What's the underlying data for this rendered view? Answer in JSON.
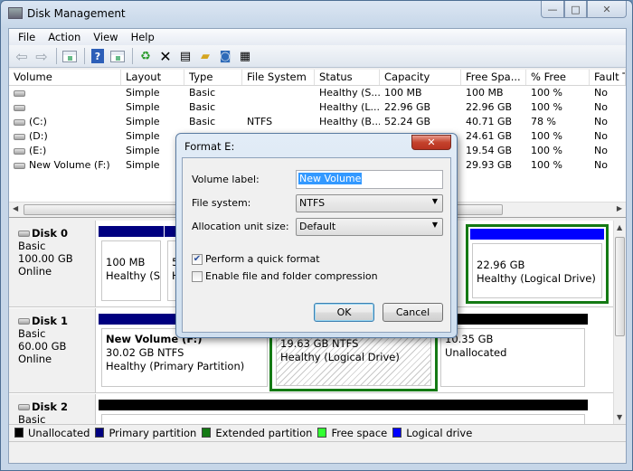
{
  "window": {
    "title": "Disk Management",
    "controls": {
      "minimize": "—",
      "maximize": "□",
      "close": "✕"
    }
  },
  "menu": [
    "File",
    "Action",
    "View",
    "Help"
  ],
  "toolbar": {
    "icons": [
      "back-icon",
      "forward-icon",
      "show-hide-console-tree-icon",
      "help-icon",
      "show-action-pane-icon",
      "refresh-icon",
      "delete-icon",
      "properties-icon",
      "open-icon",
      "explore-icon",
      "settings-icon"
    ]
  },
  "volume_list": {
    "columns": [
      "Volume",
      "Layout",
      "Type",
      "File System",
      "Status",
      "Capacity",
      "Free Spa...",
      "% Free",
      "Fault T"
    ],
    "rows": [
      {
        "volume": "",
        "layout": "Simple",
        "type": "Basic",
        "fs": "",
        "status": "Healthy (S...",
        "capacity": "100 MB",
        "free": "100 MB",
        "pct": "100 %",
        "fault": "No"
      },
      {
        "volume": "",
        "layout": "Simple",
        "type": "Basic",
        "fs": "",
        "status": "Healthy (L...",
        "capacity": "22.96 GB",
        "free": "22.96 GB",
        "pct": "100 %",
        "fault": "No"
      },
      {
        "volume": "(C:)",
        "layout": "Simple",
        "type": "Basic",
        "fs": "NTFS",
        "status": "Healthy (B...",
        "capacity": "52.24 GB",
        "free": "40.71 GB",
        "pct": "78 %",
        "fault": "No"
      },
      {
        "volume": "(D:)",
        "layout": "Simple",
        "type": "",
        "fs": "",
        "status": "",
        "capacity": "",
        "free": "24.61 GB",
        "pct": "100 %",
        "fault": "No"
      },
      {
        "volume": "(E:)",
        "layout": "Simple",
        "type": "",
        "fs": "",
        "status": "",
        "capacity": "",
        "free": "19.54 GB",
        "pct": "100 %",
        "fault": "No"
      },
      {
        "volume": "New Volume (F:)",
        "layout": "Simple",
        "type": "",
        "fs": "",
        "status": "",
        "capacity": "",
        "free": "29.93 GB",
        "pct": "100 %",
        "fault": "No"
      }
    ]
  },
  "disks": [
    {
      "name": "Disk 0",
      "type": "Basic",
      "size": "100.00 GB",
      "state": "Online",
      "partitions": [
        {
          "line1": "100 MB",
          "line2": "Healthy (Sys",
          "line3": ""
        },
        {
          "line1": "5",
          "line2": "H",
          "line3": ""
        },
        {
          "line1": "22.96 GB",
          "line2": "Healthy (Logical Drive)",
          "line3": ""
        }
      ]
    },
    {
      "name": "Disk 1",
      "type": "Basic",
      "size": "60.00 GB",
      "state": "Online",
      "partitions": [
        {
          "line1": "New Volume  (F:)",
          "line2": "30.02 GB NTFS",
          "line3": "Healthy (Primary Partition)"
        },
        {
          "line1": "19.63 GB NTFS",
          "line2": "Healthy (Logical Drive)",
          "line3": ""
        },
        {
          "line1": "10.35 GB",
          "line2": "Unallocated",
          "line3": ""
        }
      ]
    },
    {
      "name": "Disk 2",
      "type": "Basic",
      "size": "",
      "state": "",
      "partitions": []
    }
  ],
  "legend": [
    {
      "label": "Unallocated",
      "color": "#000000"
    },
    {
      "label": "Primary partition",
      "color": "#000080"
    },
    {
      "label": "Extended partition",
      "color": "#147a14"
    },
    {
      "label": "Free space",
      "color": "#33ff33"
    },
    {
      "label": "Logical drive",
      "color": "#0000ff"
    }
  ],
  "dialog": {
    "title": "Format E:",
    "volume_label": {
      "label": "Volume label:",
      "value": "New Volume"
    },
    "file_system": {
      "label": "File system:",
      "value": "NTFS"
    },
    "allocation": {
      "label": "Allocation unit size:",
      "value": "Default"
    },
    "quick_format": {
      "label": "Perform a quick format",
      "checked": true
    },
    "compression": {
      "label": "Enable file and folder compression",
      "checked": false
    },
    "ok_label": "OK",
    "cancel_label": "Cancel",
    "close_glyph": "✕"
  },
  "colors": {
    "primary": "#000080",
    "logical": "#0000ff",
    "extended": "#147a14",
    "unallocated": "#000000"
  }
}
